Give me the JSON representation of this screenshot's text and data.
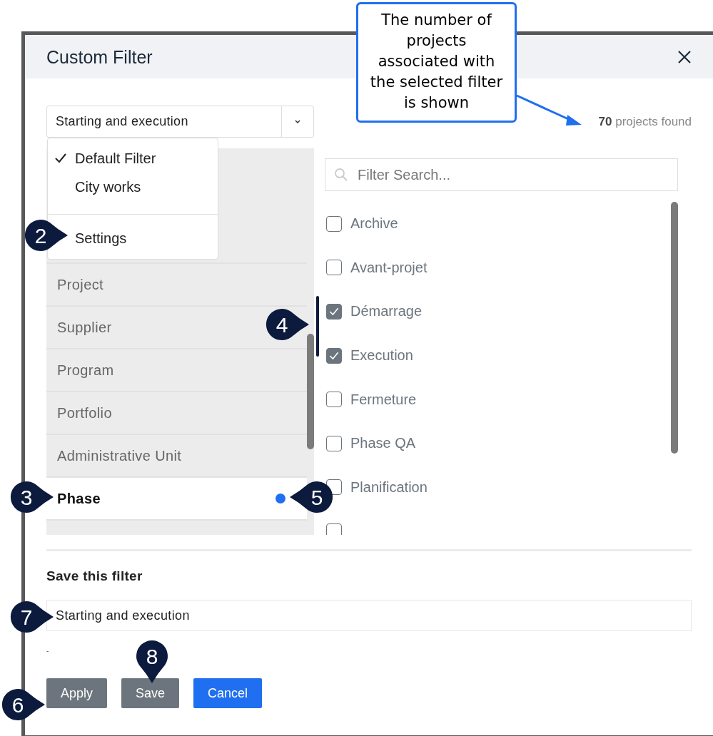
{
  "dialog": {
    "title": "Custom Filter"
  },
  "filter_select": {
    "value": "Starting and execution"
  },
  "filter_menu": {
    "items": [
      {
        "label": "Default Filter",
        "checked": true
      },
      {
        "label": "City works",
        "checked": false
      }
    ],
    "settings": "Settings"
  },
  "result_count": {
    "number": "70",
    "label": "projects found"
  },
  "categories": [
    {
      "label": "Project",
      "selected": false,
      "active": false
    },
    {
      "label": "Supplier",
      "selected": false,
      "active": false
    },
    {
      "label": "Program",
      "selected": false,
      "active": false
    },
    {
      "label": "Portfolio",
      "selected": false,
      "active": false
    },
    {
      "label": "Administrative Unit",
      "selected": false,
      "active": false
    },
    {
      "label": "Phase",
      "selected": true,
      "active": true
    }
  ],
  "option_search": {
    "placeholder": "Filter Search..."
  },
  "options": [
    {
      "label": "Archive",
      "checked": false
    },
    {
      "label": "Avant-projet",
      "checked": false
    },
    {
      "label": "Démarrage",
      "checked": true
    },
    {
      "label": "Execution",
      "checked": true
    },
    {
      "label": "Fermeture",
      "checked": false
    },
    {
      "label": "Phase QA",
      "checked": false
    },
    {
      "label": "Planification",
      "checked": false
    },
    {
      "checked": false
    }
  ],
  "save_section": {
    "heading": "Save this filter",
    "name_value": "Starting and execution",
    "note": "-"
  },
  "buttons": [
    {
      "label": "Apply",
      "kind": "secondary"
    },
    {
      "label": "Save",
      "kind": "secondary"
    },
    {
      "label": "Cancel",
      "kind": "primary"
    }
  ],
  "annotation": {
    "text": "The number of projects associated with the selected filter is shown"
  },
  "callouts": [
    {
      "number": "2"
    },
    {
      "number": "3"
    },
    {
      "number": "4"
    },
    {
      "number": "5"
    },
    {
      "number": "6"
    },
    {
      "number": "7"
    },
    {
      "number": "8"
    }
  ]
}
